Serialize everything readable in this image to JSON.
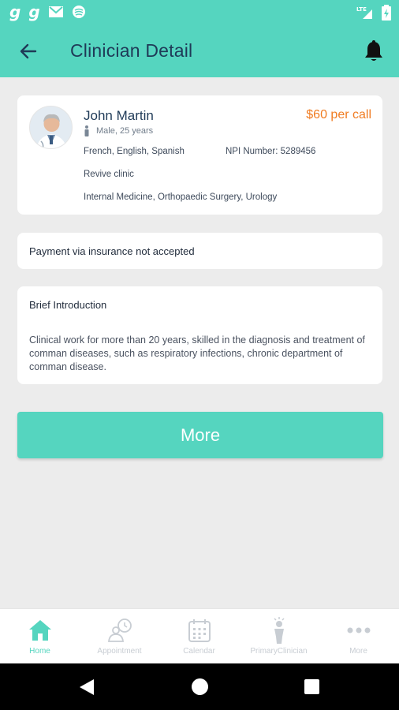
{
  "statusbar": {
    "left_icons": [
      "g-app-icon",
      "g-app-icon",
      "gmail-icon",
      "circle-app-icon"
    ],
    "right_icons": [
      "lte-signal-icon",
      "battery-charging-icon"
    ],
    "network": "LTE"
  },
  "header": {
    "title": "Clinician Detail",
    "icons": {
      "back": "arrow-left-icon",
      "notifications": "bell-icon"
    }
  },
  "clinician": {
    "name": "John Martin",
    "price": "$60 per call",
    "gender_age": "Male, 25 years",
    "languages": "French, English, Spanish",
    "npi": "NPI Number: 5289456",
    "clinic": "Revive clinic",
    "specialties": "Internal Medicine, Orthopaedic Surgery, Urology"
  },
  "payment": {
    "note": "Payment via insurance not accepted"
  },
  "intro": {
    "title": "Brief Introduction",
    "text": "Clinical work for more than 20 years, skilled in the diagnosis and treatment of comman diseases, such as respiratory infections, chronic department of comman disease."
  },
  "actions": {
    "more_label": "More"
  },
  "bottom_nav": {
    "items": [
      {
        "label": "Home",
        "icon": "home-icon",
        "active": true
      },
      {
        "label": "Appointment",
        "icon": "appointment-icon",
        "active": false
      },
      {
        "label": "Calendar",
        "icon": "calendar-icon",
        "active": false
      },
      {
        "label": "PrimaryClinician",
        "icon": "clinician-icon",
        "active": false
      },
      {
        "label": "More",
        "icon": "more-dots-icon",
        "active": false
      }
    ]
  },
  "colors": {
    "accent": "#55d5bf",
    "title_text": "#1f3a57",
    "price": "#f07c22",
    "background": "#ececec"
  }
}
